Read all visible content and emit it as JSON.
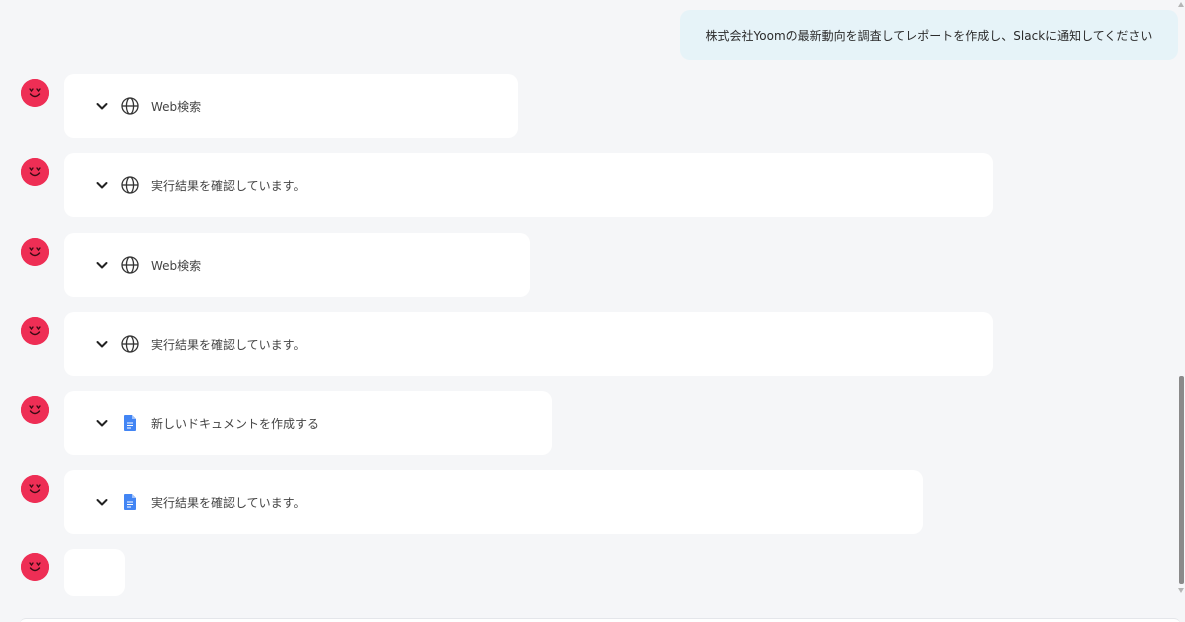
{
  "user_message": "株式会社Yoomの最新動向を調査してレポートを作成し、Slackに通知してください",
  "assistant_steps": [
    {
      "icon": "globe-icon",
      "label": "Web検索"
    },
    {
      "icon": "globe-icon",
      "label": "実行結果を確認しています。"
    },
    {
      "icon": "globe-icon",
      "label": "Web検索"
    },
    {
      "icon": "globe-icon",
      "label": "実行結果を確認しています。"
    },
    {
      "icon": "google-docs-icon",
      "label": "新しいドキュメントを作成する"
    },
    {
      "icon": "google-docs-icon",
      "label": "実行結果を確認しています。"
    }
  ],
  "colors": {
    "avatar": "#ee2e55",
    "user_bubble": "#e6f3f8",
    "background": "#f5f6f8",
    "docs_blue": "#4285f4"
  }
}
